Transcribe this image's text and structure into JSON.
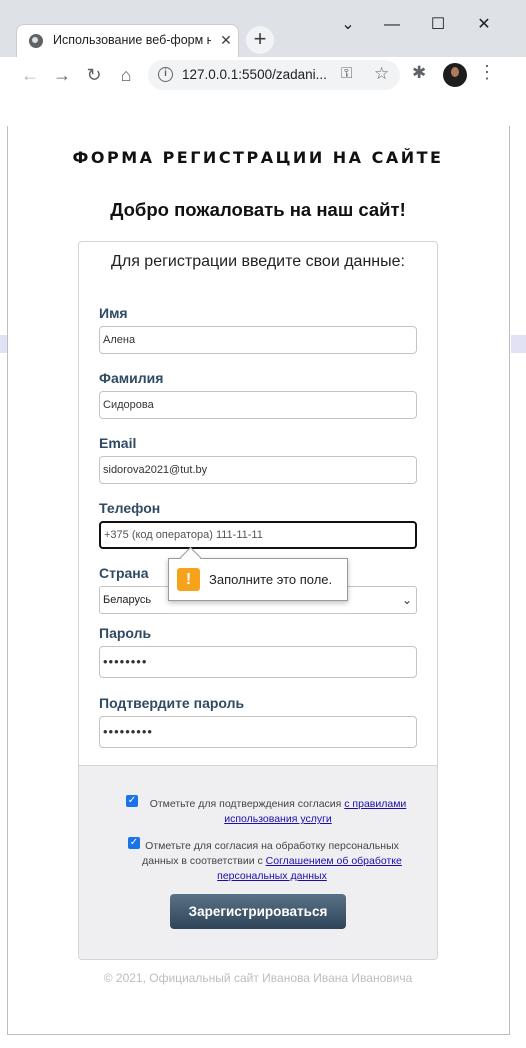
{
  "browser": {
    "tab_title": "Использование веб-форм на",
    "tab_close": "✕",
    "new_tab": "+",
    "window_controls": {
      "minimize": "—",
      "maximize": "☐",
      "close": "✕",
      "dropdown": "⌄"
    },
    "url": "127.0.0.1:5500/zadani...",
    "icons": [
      "back-icon",
      "forward-icon",
      "reload-icon",
      "home-icon",
      "info-icon",
      "key-icon",
      "star-icon",
      "extensions-icon",
      "profile-avatar",
      "menu-icon"
    ]
  },
  "page": {
    "site_title": "ФОРМА РЕГИСТРАЦИИ НА САЙТЕ",
    "welcome": "Добро пожаловать на наш сайт!",
    "intro": "Для регистрации введите свои данные:"
  },
  "form": {
    "first_name": {
      "label": "Имя",
      "value": "Алена"
    },
    "last_name": {
      "label": "Фамилия",
      "value": "Сидорова"
    },
    "email": {
      "label": "Email",
      "value": "sidorova2021@tut.by"
    },
    "phone": {
      "label": "Телефон",
      "placeholder": "+375 (код оператора) 111-11-11"
    },
    "country": {
      "label": "Страна",
      "selected": "Беларусь"
    },
    "password": {
      "label": "Пароль",
      "value": "••••••••"
    },
    "password_confirm": {
      "label": "Подтвердите пароль",
      "value": "•••••••••"
    },
    "validation_tooltip": "Заполните это поле."
  },
  "consents": {
    "terms_text": "Отметьте для подтверждения согласия",
    "terms_link": "с правилами использования услуги",
    "privacy_text": "Отметьте для согласия на обработку персональных данных в соответствии с",
    "privacy_link": "Соглашением об обработке персональных данных"
  },
  "submit_label": "Зарегистрироваться",
  "footer": "© 2021, Официальный сайт Иванова Ивана Ивановича",
  "colors": {
    "label": "#2f4b64",
    "button": "#3b5266",
    "link": "#1a0dab",
    "warning": "#f7a21b",
    "checkbox": "#1a73e8"
  }
}
